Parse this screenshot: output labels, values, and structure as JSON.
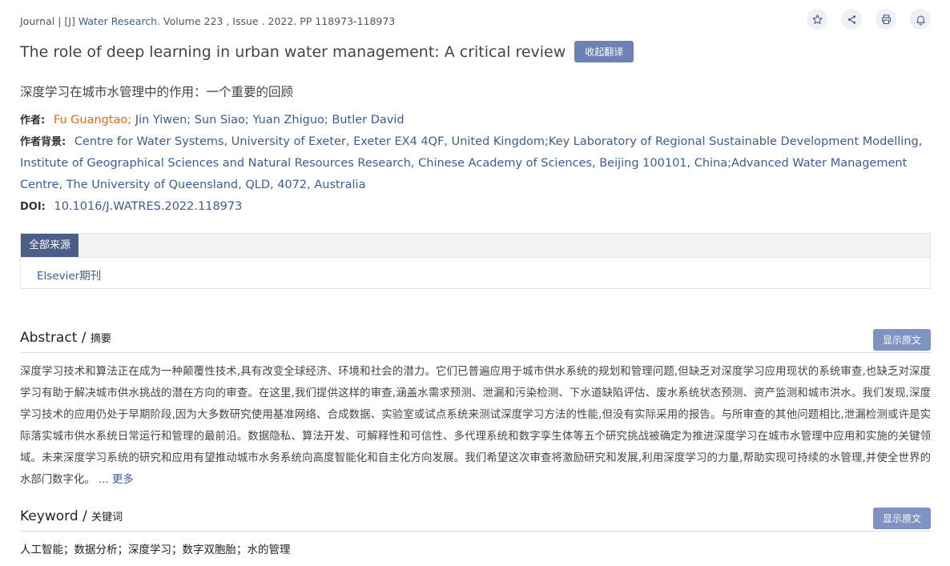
{
  "header": {
    "journal_prefix": "Journal | [J] ",
    "journal_name": "Water Research",
    "journal_suffix": ". Volume 223 , Issue . 2022. PP 118973-118973"
  },
  "icons": [
    "star-icon",
    "share-icon",
    "print-icon",
    "bell-icon"
  ],
  "title": "The role of deep learning in urban water management: A critical review",
  "collapse_translation_label": "收起翻译",
  "title_cn": "深度学习在城市水管理中的作用：一个重要的回顾",
  "authors": {
    "label": "作者:",
    "first": "Fu Guangtao;",
    "rest": " Jin Yiwen; Sun Siao; Yuan Zhiguo; Butler David"
  },
  "affiliation": {
    "label": "作者背景:",
    "text": "Centre for Water Systems, University of Exeter, Exeter EX4 4QF, United Kingdom;Key Laboratory of Regional Sustainable Development Modelling, Institute of Geographical Sciences and Natural Resources Research, Chinese Academy of Sciences, Beijing 100101, China;Advanced Water Management Centre, The University of Queensland, QLD, 4072, Australia"
  },
  "doi": {
    "label": "DOI:",
    "value": "10.1016/J.WATRES.2022.118973"
  },
  "sources": {
    "tab": "全部来源",
    "link": "Elsevier期刊"
  },
  "abstract": {
    "title": "Abstract /",
    "title_cn": "摘要",
    "show_original": "显示原文",
    "text": "深度学习技术和算法正在成为一种颠覆性技术,具有改变全球经济、环境和社会的潜力。它们已普遍应用于城市供水系统的规划和管理问题,但缺乏对深度学习应用现状的系统审查,也缺乏对深度学习有助于解决城市供水挑战的潜在方向的审查。在这里,我们提供这样的审查,涵盖水需求预测、泄漏和污染检测、下水道缺陷评估、废水系统状态预测、资产监测和城市洪水。我们发现,深度学习技术的应用仍处于早期阶段,因为大多数研究使用基准网络、合成数据、实验室或试点系统来测试深度学习方法的性能,但没有实际采用的报告。与所审查的其他问题相比,泄漏检测或许是实际落实城市供水系统日常运行和管理的最前沿。数据隐私、算法开发、可解释性和可信性、多代理系统和数字孪生体等五个研究挑战被确定为推进深度学习在城市水管理中应用和实施的关键领域。未来深度学习系统的研究和应用有望推动城市水务系统向高度智能化和自主化方向发展。我们希望这次审查将激励研究和发展,利用深度学习的力量,帮助实现可持续的水管理,并使全世界的水部门数字化。",
    "more": "... 更多"
  },
  "keyword": {
    "title": "Keyword /",
    "title_cn": "关键词",
    "show_original": "显示原文",
    "text": "人工智能；数据分析；深度学习；数字双胞胎；水的管理"
  },
  "colors": {
    "accent_button": "#6d82b4",
    "link": "#3a5d96",
    "first_author": "#e86a1f",
    "source_tab": "#4c5d88"
  }
}
